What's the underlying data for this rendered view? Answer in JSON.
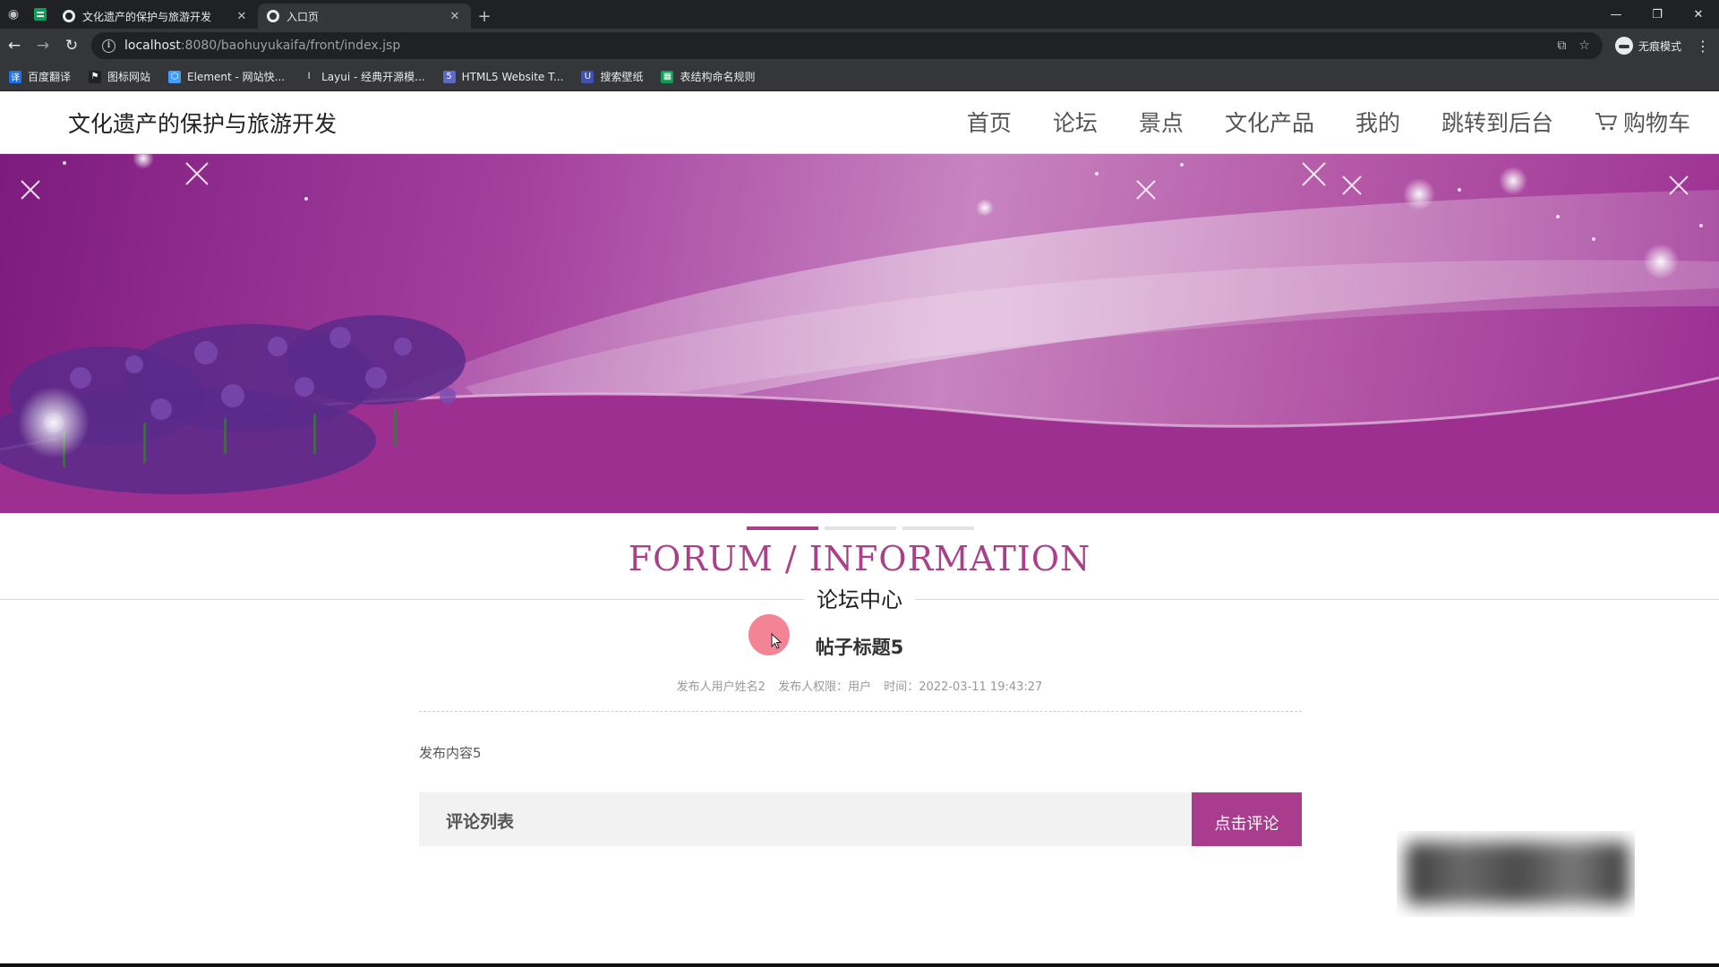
{
  "browser": {
    "tabs": [
      {
        "title": "文化遗产的保护与旅游开发",
        "close": "✕"
      },
      {
        "title": "入口页",
        "close": "✕"
      }
    ],
    "new_tab": "+",
    "window_controls": {
      "minimize": "—",
      "restore": "❐",
      "close": "✕"
    },
    "url_host": "localhost",
    "url_path": ":8080/baohuyukaifa/front/index.jsp",
    "profile_label": "无痕模式",
    "bookmarks": [
      {
        "label": "百度翻译",
        "icon": "translate-icon",
        "color": "#1a73e8"
      },
      {
        "label": "图标网站",
        "icon": "flag-icon",
        "color": "#202124"
      },
      {
        "label": "Element - 网站快...",
        "icon": "element-icon",
        "color": "#409eff"
      },
      {
        "label": "Layui - 经典开源模...",
        "icon": "layui-icon",
        "color": "#35363a"
      },
      {
        "label": "HTML5 Website T...",
        "icon": "html5-icon",
        "color": "#5c6bc0"
      },
      {
        "label": "搜索壁纸",
        "icon": "wallpaper-icon",
        "color": "#3f51b5"
      },
      {
        "label": "表结构命名规则",
        "icon": "sheet-icon",
        "color": "#0f9d58"
      }
    ]
  },
  "site": {
    "title": "文化遗产的保护与旅游开发",
    "nav": [
      "首页",
      "论坛",
      "景点",
      "文化产品",
      "我的",
      "跳转到后台",
      "购物车"
    ]
  },
  "section": {
    "title_en": "FORUM / INFORMATION",
    "title_cn": "论坛中心"
  },
  "post": {
    "title": "帖子标题5",
    "author": "发布人用户姓名2",
    "role": "发布人权限：用户",
    "time": "时间：2022-03-11 19:43:27",
    "content": "发布内容5"
  },
  "comments": {
    "label": "评论列表",
    "button": "点击评论"
  },
  "colors": {
    "accent": "#a93c8d",
    "title_en": "#a9418a"
  }
}
